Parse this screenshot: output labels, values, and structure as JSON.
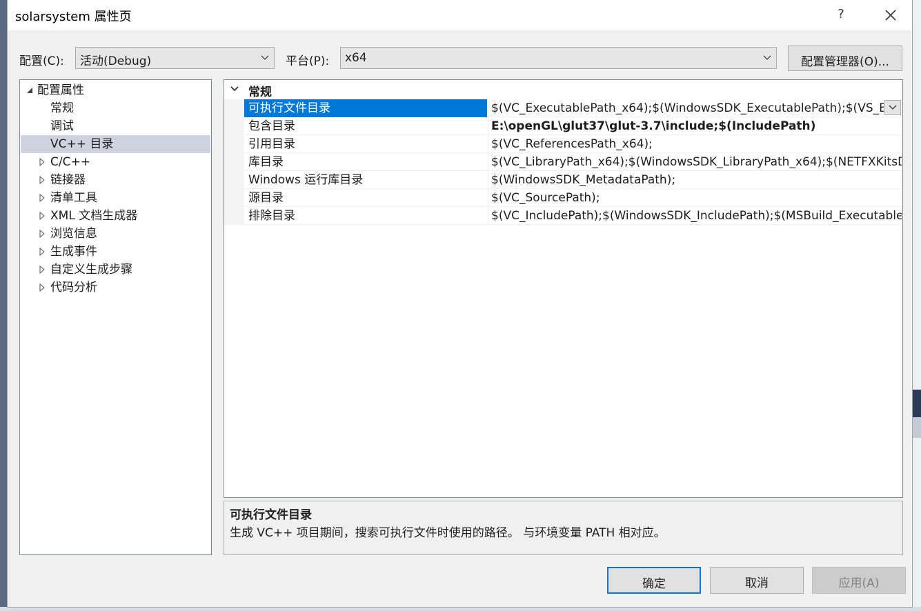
{
  "window": {
    "title": "solarsystem 属性页",
    "help_label": "?"
  },
  "config_bar": {
    "config_label": "配置(C):",
    "config_value": "活动(Debug)",
    "platform_label": "平台(P):",
    "platform_value": "x64",
    "manager_button": "配置管理器(O)..."
  },
  "tree": {
    "root": "配置属性",
    "items": [
      {
        "label": "常规"
      },
      {
        "label": "调试"
      },
      {
        "label": "VC++ 目录"
      },
      {
        "label": "C/C++"
      },
      {
        "label": "链接器"
      },
      {
        "label": "清单工具"
      },
      {
        "label": "XML 文档生成器"
      },
      {
        "label": "浏览信息"
      },
      {
        "label": "生成事件"
      },
      {
        "label": "自定义生成步骤"
      },
      {
        "label": "代码分析"
      }
    ]
  },
  "grid": {
    "group": "常规",
    "rows": [
      {
        "name": "可执行文件目录",
        "value": "$(VC_ExecutablePath_x64);$(WindowsSDK_ExecutablePath);$(VS_ExecutablePath)"
      },
      {
        "name": "包含目录",
        "value": "E:\\openGL\\glut37\\glut-3.7\\include;$(IncludePath)"
      },
      {
        "name": "引用目录",
        "value": "$(VC_ReferencesPath_x64);"
      },
      {
        "name": "库目录",
        "value": "$(VC_LibraryPath_x64);$(WindowsSDK_LibraryPath_x64);$(NETFXKitsDir)"
      },
      {
        "name": "Windows 运行库目录",
        "value": "$(WindowsSDK_MetadataPath);"
      },
      {
        "name": "源目录",
        "value": "$(VC_SourcePath);"
      },
      {
        "name": "排除目录",
        "value": "$(VC_IncludePath);$(WindowsSDK_IncludePath);$(MSBuild_ExecutablePath)"
      }
    ]
  },
  "description": {
    "title": "可执行文件目录",
    "text": "生成 VC++ 项目期间，搜索可执行文件时使用的路径。 与环境变量 PATH 相对应。"
  },
  "buttons": {
    "ok": "确定",
    "cancel": "取消",
    "apply": "应用(A)"
  },
  "colors": {
    "selection": "#0078d7",
    "tree_selection": "#cfd3df",
    "dialog_bg": "#f0f0f0"
  }
}
